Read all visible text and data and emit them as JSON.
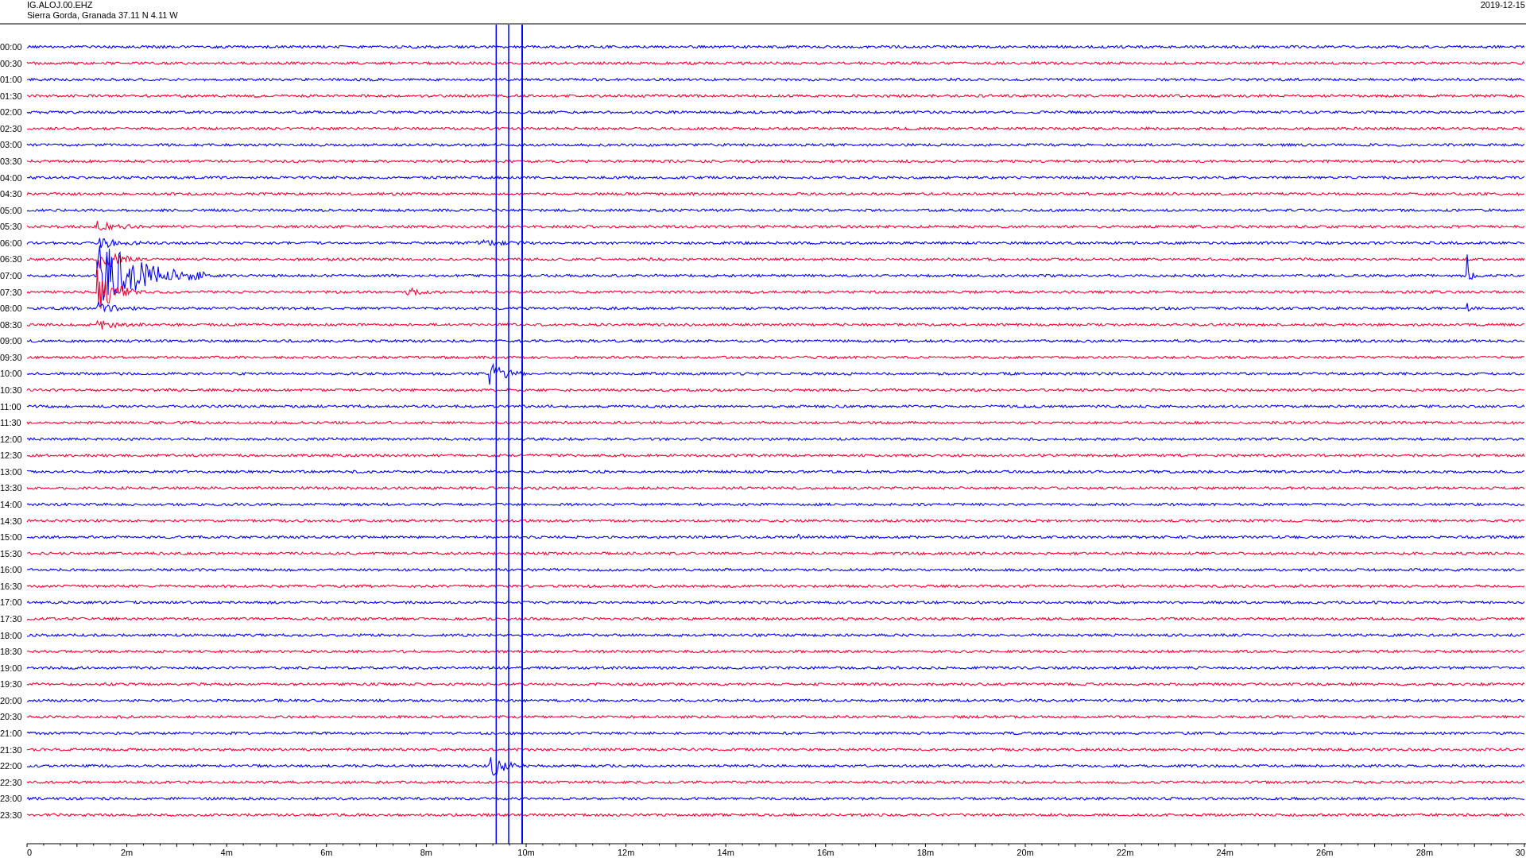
{
  "header": {
    "station": "IG.ALOJ.00.EHZ",
    "location": "Sierra Gorda, Granada  37.11 N 4.11 W",
    "date": "2019-12-15"
  },
  "traces": [
    {
      "label": "00:00",
      "color": "#0000ff"
    },
    {
      "label": "00:30",
      "color": "#ff0033"
    },
    {
      "label": "01:00",
      "color": "#0000ff"
    },
    {
      "label": "01:30",
      "color": "#ff0033"
    },
    {
      "label": "02:00",
      "color": "#0000ff"
    },
    {
      "label": "02:30",
      "color": "#ff0033"
    },
    {
      "label": "03:00",
      "color": "#0000ff"
    },
    {
      "label": "03:30",
      "color": "#ff0033"
    },
    {
      "label": "04:00",
      "color": "#0000ff"
    },
    {
      "label": "04:30",
      "color": "#ff0033"
    },
    {
      "label": "05:00",
      "color": "#0000ff"
    },
    {
      "label": "05:30",
      "color": "#ff0033"
    },
    {
      "label": "06:00",
      "color": "#0000ff"
    },
    {
      "label": "06:30",
      "color": "#ff0033"
    },
    {
      "label": "07:00",
      "color": "#0000ff"
    },
    {
      "label": "07:30",
      "color": "#ff0033"
    },
    {
      "label": "08:00",
      "color": "#0000ff"
    },
    {
      "label": "08:30",
      "color": "#ff0033"
    },
    {
      "label": "09:00",
      "color": "#0000ff"
    },
    {
      "label": "09:30",
      "color": "#ff0033"
    },
    {
      "label": "10:00",
      "color": "#0000ff"
    },
    {
      "label": "10:30",
      "color": "#ff0033"
    },
    {
      "label": "11:00",
      "color": "#0000ff"
    },
    {
      "label": "11:30",
      "color": "#ff0033"
    },
    {
      "label": "12:00",
      "color": "#0000ff"
    },
    {
      "label": "12:30",
      "color": "#ff0033"
    },
    {
      "label": "13:00",
      "color": "#0000ff"
    },
    {
      "label": "13:30",
      "color": "#ff0033"
    },
    {
      "label": "14:00",
      "color": "#0000ff"
    },
    {
      "label": "14:30",
      "color": "#ff0033"
    },
    {
      "label": "15:00",
      "color": "#0000ff"
    },
    {
      "label": "15:30",
      "color": "#ff0033"
    },
    {
      "label": "16:00",
      "color": "#0000ff"
    },
    {
      "label": "16:30",
      "color": "#ff0033"
    },
    {
      "label": "17:00",
      "color": "#0000ff"
    },
    {
      "label": "17:30",
      "color": "#ff0033"
    },
    {
      "label": "18:00",
      "color": "#0000ff"
    },
    {
      "label": "18:30",
      "color": "#ff0033"
    },
    {
      "label": "19:00",
      "color": "#0000ff"
    },
    {
      "label": "19:30",
      "color": "#ff0033"
    },
    {
      "label": "20:00",
      "color": "#0000ff"
    },
    {
      "label": "20:30",
      "color": "#ff0033"
    },
    {
      "label": "21:00",
      "color": "#0000ff"
    },
    {
      "label": "21:30",
      "color": "#ff0033"
    },
    {
      "label": "22:00",
      "color": "#0000ff"
    },
    {
      "label": "22:30",
      "color": "#ff0033"
    },
    {
      "label": "23:00",
      "color": "#0000ff"
    },
    {
      "label": "23:30",
      "color": "#ff0033"
    }
  ],
  "x_axis": {
    "tick_labels": [
      "0",
      "2m",
      "4m",
      "6m",
      "8m",
      "10m",
      "12m",
      "14m",
      "16m",
      "18m",
      "20m",
      "22m",
      "24m",
      "26m",
      "28m",
      "30"
    ]
  }
}
